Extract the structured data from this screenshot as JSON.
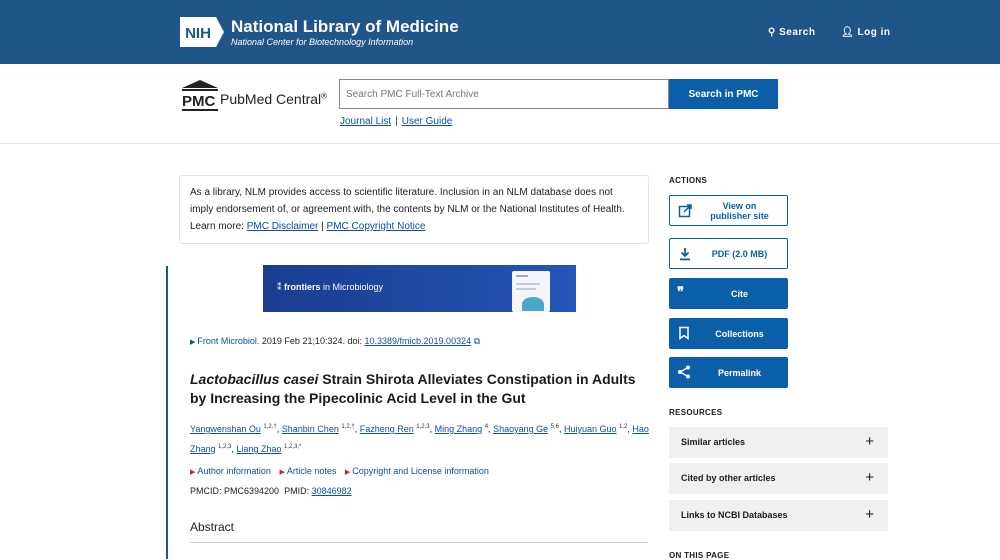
{
  "header": {
    "logo_text": "NIH",
    "title": "National Library of Medicine",
    "subtitle": "National Center for Biotechnology Information",
    "search_label": "Search",
    "login_label": "Log in",
    "bg_color": "#20558a"
  },
  "search": {
    "logo_abbr": "PMC",
    "logo_name": "PubMed Central",
    "logo_reg": "®",
    "placeholder": "Search PMC Full-Text Archive",
    "button_label": "Search in PMC",
    "journal_list": "Journal List",
    "separator": "|",
    "user_guide": "User Guide"
  },
  "disclaimer": {
    "line1": "As a library, NLM provides access to scientific literature. Inclusion in an NLM database does not",
    "line2": "imply endorsement of, or agreement with, the contents by NLM or the National Institutes of Health.",
    "learn_more": "Learn more: ",
    "link1": "PMC Disclaimer",
    "sep": " | ",
    "link2": "PMC Copyright Notice"
  },
  "banner": {
    "brand": "frontiers",
    "journal": " in Microbiology"
  },
  "article": {
    "journal": "Front Microbiol.",
    "citation_rest": " 2019 Feb 21;10:324. doi: ",
    "doi": "10.3389/fmicb.2019.00324",
    "title_italic": "Lactobacillus casei",
    "title_rest": " Strain Shirota Alleviates Constipation in Adults by Increasing the Pipecolinic Acid Level in the Gut",
    "authors": [
      {
        "name": "Yangwenshan Ou",
        "sup": "1,2,†"
      },
      {
        "name": "Shanbin Chen",
        "sup": "1,2,†"
      },
      {
        "name": "Fazheng Ren",
        "sup": "1,2,3"
      },
      {
        "name": "Ming Zhang",
        "sup": "4"
      },
      {
        "name": "Shaoyang Ge",
        "sup": "5,6"
      },
      {
        "name": "Huiyuan Guo",
        "sup": "1,2"
      },
      {
        "name": "Hao Zhang",
        "sup": "1,2,3"
      },
      {
        "name": "Liang Zhao",
        "sup": "1,2,3,*"
      }
    ],
    "author_info": "Author information",
    "article_notes": "Article notes",
    "copyright": "Copyright and License information",
    "pmcid_label": "PMCID: PMC6394200",
    "pmid_label": "PMID: ",
    "pmid": "30846982",
    "abstract_heading": "Abstract"
  },
  "sidebar": {
    "actions_heading": "ACTIONS",
    "view_publisher": "View on publisher site",
    "pdf": "PDF (2.0 MB)",
    "cite": "Cite",
    "collections": "Collections",
    "permalink": "Permalink",
    "resources_heading": "RESOURCES",
    "resources": [
      "Similar articles",
      "Cited by other articles",
      "Links to NCBI Databases"
    ],
    "plus": "+",
    "on_this_page": "ON THIS PAGE"
  }
}
